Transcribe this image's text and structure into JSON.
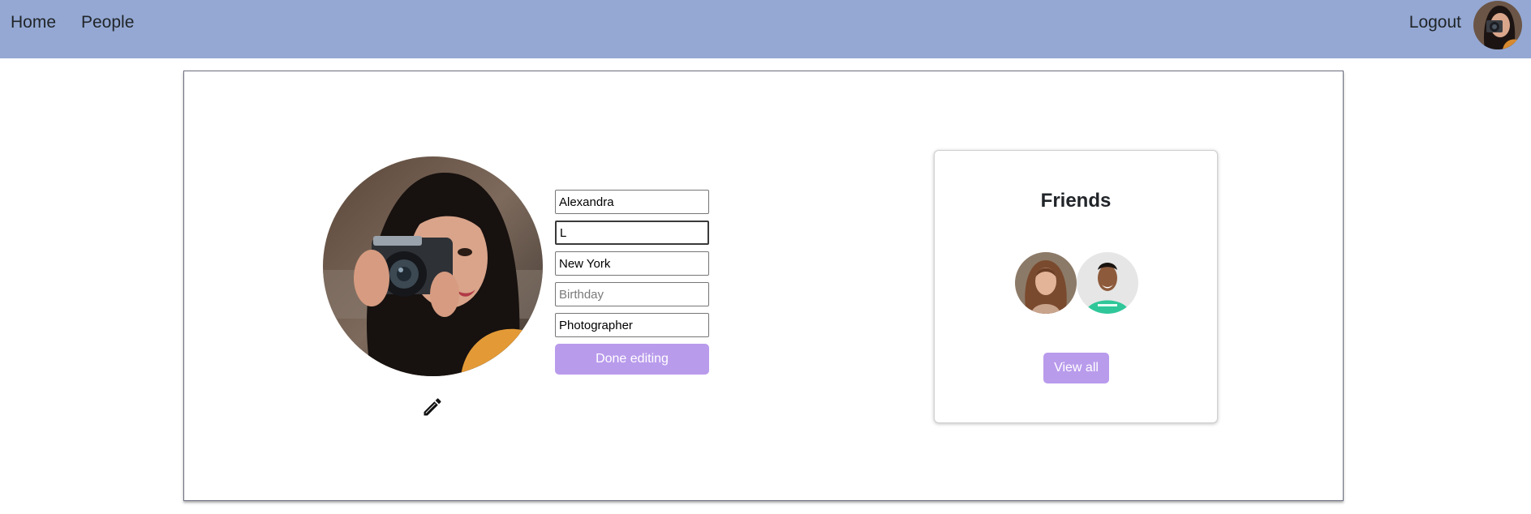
{
  "nav": {
    "home_label": "Home",
    "people_label": "People",
    "logout_label": "Logout"
  },
  "profile": {
    "fields": {
      "first_name": "Alexandra",
      "last_name": "L",
      "location": "New York",
      "birthday_placeholder": "Birthday",
      "occupation": "Photographer"
    },
    "done_button_label": "Done editing",
    "edit_icon": "pencil-icon"
  },
  "friends": {
    "title": "Friends",
    "view_all_label": "View all"
  },
  "colors": {
    "navbar_bg": "#94a8d3",
    "button_bg": "#b99bec"
  }
}
